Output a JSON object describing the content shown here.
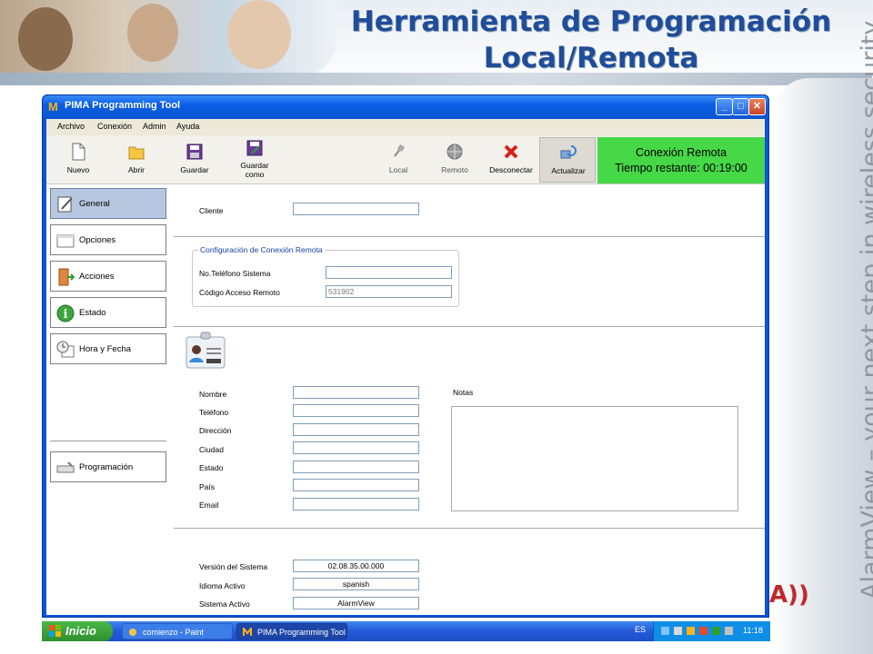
{
  "slide": {
    "title": "Herramienta de Programación Local/Remota",
    "tagline": "AlarmView – your next step in wireless security"
  },
  "window": {
    "title": "PIMA Programming Tool",
    "controls": [
      "_",
      "□",
      "✕"
    ]
  },
  "menu": [
    "Archivo",
    "Conexión",
    "Admin",
    "Ayuda"
  ],
  "toolbar": {
    "buttons": [
      {
        "label": "Nuevo",
        "icon": "new-file-icon"
      },
      {
        "label": "Abrir",
        "icon": "open-folder-icon"
      },
      {
        "label": "Guardar",
        "icon": "save-disk-icon"
      },
      {
        "label": "Guardar como",
        "icon": "save-as-icon"
      },
      {
        "label": "Local",
        "icon": "plug-icon"
      },
      {
        "label": "Remoto",
        "icon": "globe-icon"
      },
      {
        "label": "Desconectar",
        "icon": "disconnect-icon"
      },
      {
        "label": "Actualizar",
        "icon": "refresh-icon"
      }
    ],
    "status_line1": "Conexión Remota",
    "status_line2": "Tiempo restante: 00:19:00",
    "status_color": "#46d846"
  },
  "nav": [
    {
      "label": "General",
      "active": true
    },
    {
      "label": "Opciones"
    },
    {
      "label": "Acciones"
    },
    {
      "label": "Estado"
    },
    {
      "label": "Hora y Fecha"
    },
    {
      "label": "Programación"
    }
  ],
  "form": {
    "cliente_label": "Cliente",
    "cliente_value": "",
    "group_title": "Configuración de Conexión Remota",
    "telefono_sistema_label": "No.Teléfono Sistema",
    "telefono_sistema_value": "",
    "codigo_acceso_label": "Código Acceso Remoto",
    "codigo_acceso_value": "531902",
    "nombre_label": "Nombre",
    "telefono_label": "Teléfono",
    "direccion_label": "Dirección",
    "ciudad_label": "Ciudad",
    "estado_label": "Estado",
    "pais_label": "País",
    "email_label": "Email",
    "notas_label": "Notas",
    "version_label": "Versión del Sistema",
    "version_value": "02.08.35.00.000",
    "idioma_label": "Idioma Activo",
    "idioma_value": "spanish",
    "sistema_label": "Sistema Activo",
    "sistema_value": "AlarmView"
  },
  "taskbar": {
    "start_label": "Inicio",
    "tasks": [
      "comienzo - Paint",
      "PIMA Programming Tool"
    ],
    "lang": "ES",
    "clock": "11:18"
  }
}
